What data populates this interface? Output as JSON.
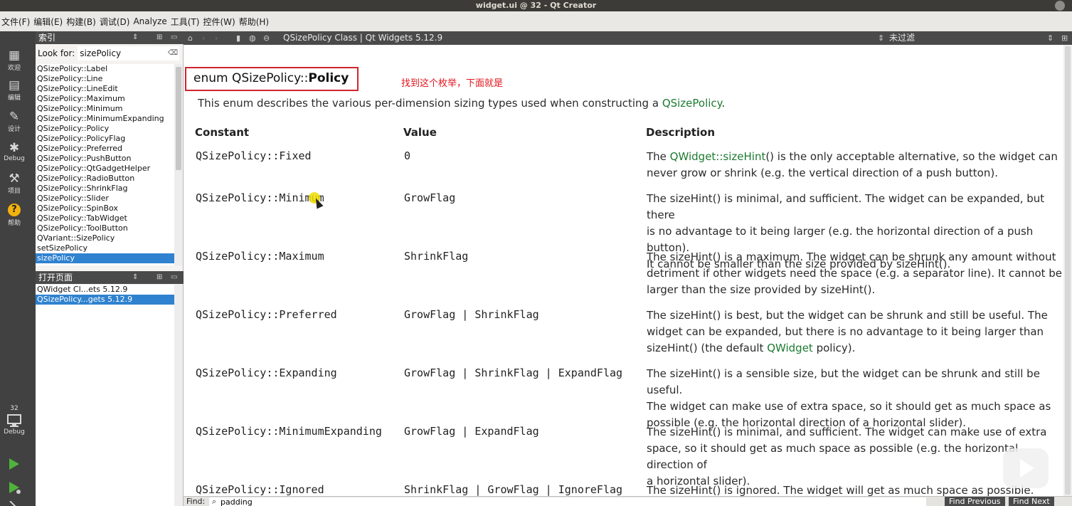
{
  "window": {
    "title": "widget.ui @ 32 - Qt Creator"
  },
  "menu": [
    "文件(F)",
    "编辑(E)",
    "构建(B)",
    "调试(D)",
    "Analyze",
    "工具(T)",
    "控件(W)",
    "帮助(H)"
  ],
  "modes": [
    {
      "label": "欢迎",
      "icon": "grid-icon",
      "glyph": "▦"
    },
    {
      "label": "编辑",
      "icon": "document-icon",
      "glyph": "▤"
    },
    {
      "label": "设计",
      "icon": "pencil-icon",
      "glyph": "✎"
    },
    {
      "label": "Debug",
      "icon": "bug-icon",
      "glyph": "✱"
    },
    {
      "label": "项目",
      "icon": "wrench-icon",
      "glyph": "⚒"
    },
    {
      "label": "帮助",
      "icon": "help-icon",
      "glyph": "?"
    }
  ],
  "kit": {
    "name": "32",
    "label": "Debug"
  },
  "index_pane": {
    "title": "索引",
    "look_for_label": "Look for:",
    "search_value": "sizePolicy",
    "items": [
      "QSizePolicy::Label",
      "QSizePolicy::Line",
      "QSizePolicy::LineEdit",
      "QSizePolicy::Maximum",
      "QSizePolicy::Minimum",
      "QSizePolicy::MinimumExpanding",
      "QSizePolicy::Policy",
      "QSizePolicy::PolicyFlag",
      "QSizePolicy::Preferred",
      "QSizePolicy::PushButton",
      "QSizePolicy::QtGadgetHelper",
      "QSizePolicy::RadioButton",
      "QSizePolicy::ShrinkFlag",
      "QSizePolicy::Slider",
      "QSizePolicy::SpinBox",
      "QSizePolicy::TabWidget",
      "QSizePolicy::ToolButton",
      "QVariant::SizePolicy",
      "setSizePolicy",
      "sizePolicy"
    ],
    "selected_index": 19
  },
  "open_pages": {
    "title": "打开页面",
    "items": [
      "QWidget Cl...ets 5.12.9",
      "QSizePolicy...gets 5.12.9"
    ],
    "selected_index": 1
  },
  "doc_toolbar": {
    "page_title": "QSizePolicy Class | Qt Widgets 5.12.9",
    "filter": "未过滤"
  },
  "doc": {
    "heading_prefix": "enum QSizePolicy::",
    "heading_bold": "Policy",
    "annotation": "找到这个枚举，下面就是",
    "intro_text": "This enum describes the various per-dimension sizing types used when constructing a ",
    "intro_link": "QSizePolicy",
    "intro_end": ".",
    "headers": {
      "constant": "Constant",
      "value": "Value",
      "description": "Description"
    },
    "rows": [
      {
        "constant": "QSizePolicy::Fixed",
        "value": "0",
        "lines": [
          [
            {
              "t": "The "
            },
            {
              "t": "QWidget::sizeHint",
              "link": true
            },
            {
              "t": "() is the only acceptable alternative, so the widget can"
            }
          ],
          [
            {
              "t": "never grow or shrink (e.g. the vertical direction of a push button)."
            }
          ]
        ]
      },
      {
        "constant": "QSizePolicy::Minimum",
        "value": "GrowFlag",
        "lines": [
          [
            {
              "t": "The sizeHint() is minimal, and sufficient. The widget can be expanded, but there"
            }
          ],
          [
            {
              "t": "is no advantage to it being larger (e.g. the horizontal direction of a push button)."
            }
          ],
          [
            {
              "t": "It cannot be smaller than the size provided by sizeHint()."
            }
          ]
        ]
      },
      {
        "constant": "QSizePolicy::Maximum",
        "value": "ShrinkFlag",
        "lines": [
          [
            {
              "t": "The sizeHint() is a maximum. The widget can be shrunk any amount without"
            }
          ],
          [
            {
              "t": "detriment if other widgets need the space (e.g. a separator line). It cannot be"
            }
          ],
          [
            {
              "t": "larger than the size provided by sizeHint()."
            }
          ]
        ]
      },
      {
        "constant": "QSizePolicy::Preferred",
        "value": "GrowFlag | ShrinkFlag",
        "lines": [
          [
            {
              "t": "The sizeHint() is best, but the widget can be shrunk and still be useful. The"
            }
          ],
          [
            {
              "t": "widget can be expanded, but there is no advantage to it being larger than"
            }
          ],
          [
            {
              "t": "sizeHint() (the default "
            },
            {
              "t": "QWidget",
              "link": true
            },
            {
              "t": " policy)."
            }
          ]
        ]
      },
      {
        "constant": "QSizePolicy::Expanding",
        "value": "GrowFlag | ShrinkFlag | ExpandFlag",
        "lines": [
          [
            {
              "t": "The sizeHint() is a sensible size, but the widget can be shrunk and still be useful."
            }
          ],
          [
            {
              "t": "The widget can make use of extra space, so it should get as much space as"
            }
          ],
          [
            {
              "t": "possible (e.g. the horizontal direction of a horizontal slider)."
            }
          ]
        ]
      },
      {
        "constant": "QSizePolicy::MinimumExpanding",
        "value": "GrowFlag | ExpandFlag",
        "lines": [
          [
            {
              "t": "The sizeHint() is minimal, and sufficient. The widget can make use of extra"
            }
          ],
          [
            {
              "t": "space, so it should get as much space as possible (e.g. the horizontal direction of"
            }
          ],
          [
            {
              "t": "a horizontal slider)."
            }
          ]
        ]
      },
      {
        "constant": "QSizePolicy::Ignored",
        "value": "ShrinkFlag | GrowFlag | IgnoreFlag",
        "lines": [
          [
            {
              "t": "The sizeHint() is ignored. The widget will get as much space as possible."
            }
          ]
        ]
      }
    ]
  },
  "find_bar": {
    "label": "Find:",
    "value": "padding",
    "prev_label": "Find Previous",
    "next_label": "Find Next"
  }
}
